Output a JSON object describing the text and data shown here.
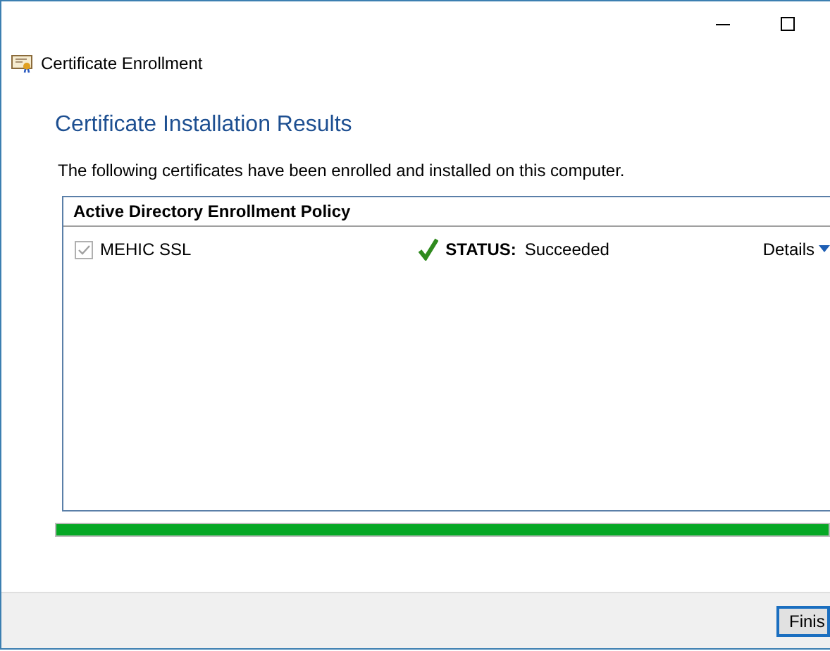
{
  "window": {
    "title": "Certificate Enrollment"
  },
  "heading": "Certificate Installation Results",
  "description": "The following certificates have been enrolled and installed on this computer.",
  "policy": {
    "title": "Active Directory Enrollment Policy",
    "certificates": [
      {
        "name": "MEHIC SSL",
        "checked": true,
        "disabled": true,
        "status_label": "STATUS:",
        "status": "Succeeded",
        "succeeded": true,
        "details": "Details"
      }
    ]
  },
  "progress": {
    "level": 1
  },
  "buttons": [
    "Finis"
  ]
}
